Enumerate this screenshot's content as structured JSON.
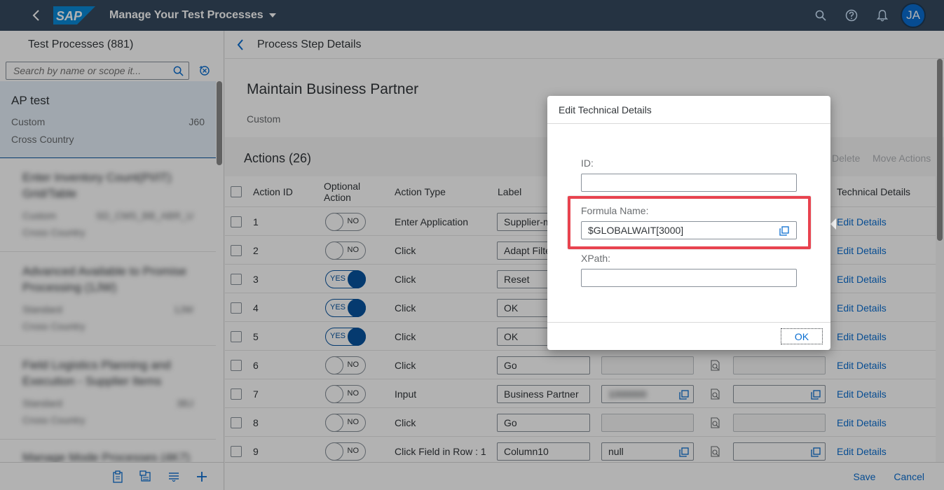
{
  "shell": {
    "logo_text": "SAP",
    "app_title": "Manage Your Test Processes",
    "avatar_initials": "JA"
  },
  "master": {
    "title": "Test Processes (881)",
    "search_placeholder": "Search by name or scope it...",
    "items": [
      {
        "title": "AP test",
        "type": "Custom",
        "code": "J60",
        "scope": "Cross Country"
      },
      {
        "title": "Enter Inventory Count(PI/IT) Grid/Table",
        "type": "Custom",
        "code": "SD_CMS_BB_ABR_U",
        "scope": "Cross Country"
      },
      {
        "title": "Advanced Available to Promise Processing (1JW)",
        "type": "Standard",
        "code": "1JW",
        "scope": "Cross Country"
      },
      {
        "title": "Field Logistics Planning and Execution - Supplier Items",
        "type": "Standard",
        "code": "3BJ",
        "scope": "Cross Country"
      },
      {
        "title": "Manage Mode Processes (4K7)",
        "type": "",
        "code": "",
        "scope": ""
      }
    ]
  },
  "detail": {
    "header_title": "Process Step Details",
    "object_title": "Maintain Business Partner",
    "object_subtitle": "Custom",
    "actions_title": "Actions (26)",
    "toolbar": {
      "delete": "Delete",
      "move_actions": "Move Actions"
    },
    "columns": {
      "action_id": "Action ID",
      "optional_action": "Optional Action",
      "action_type": "Action Type",
      "label": "Label",
      "technical_details": "Technical Details"
    },
    "rows": [
      {
        "id": "1",
        "optional": "NO",
        "type": "Enter Application",
        "label": "Supplier-m",
        "value": "",
        "link": "Edit Details"
      },
      {
        "id": "2",
        "optional": "NO",
        "type": "Click",
        "label": "Adapt Filte",
        "value": "",
        "link": "Edit Details"
      },
      {
        "id": "3",
        "optional": "YES",
        "type": "Click",
        "label": "Reset",
        "value": "",
        "link": "Edit Details"
      },
      {
        "id": "4",
        "optional": "YES",
        "type": "Click",
        "label": "OK",
        "value": "",
        "link": "Edit Details"
      },
      {
        "id": "5",
        "optional": "YES",
        "type": "Click",
        "label": "OK",
        "value": "",
        "link": "Edit Details"
      },
      {
        "id": "6",
        "optional": "NO",
        "type": "Click",
        "label": "Go",
        "value": "",
        "link": "Edit Details"
      },
      {
        "id": "7",
        "optional": "NO",
        "type": "Input",
        "label": "Business Partner",
        "value": "1000000",
        "link": "Edit Details"
      },
      {
        "id": "8",
        "optional": "NO",
        "type": "Click",
        "label": "Go",
        "value": "",
        "link": "Edit Details"
      },
      {
        "id": "9",
        "optional": "NO",
        "type": "Click Field in Row : 1",
        "label": "Column10",
        "value": "null",
        "link": "Edit Details"
      }
    ],
    "footer": {
      "save": "Save",
      "cancel": "Cancel"
    }
  },
  "dialog": {
    "title": "Edit Technical Details",
    "id_label": "ID:",
    "id_value": "",
    "formula_label": "Formula Name:",
    "formula_value": "$GLOBALWAIT[3000]",
    "xpath_label": "XPath:",
    "xpath_value": "",
    "ok_label": "OK"
  },
  "colors": {
    "shell": "#354a5f",
    "accent": "#0a6ed1",
    "highlight": "#e8434f"
  }
}
